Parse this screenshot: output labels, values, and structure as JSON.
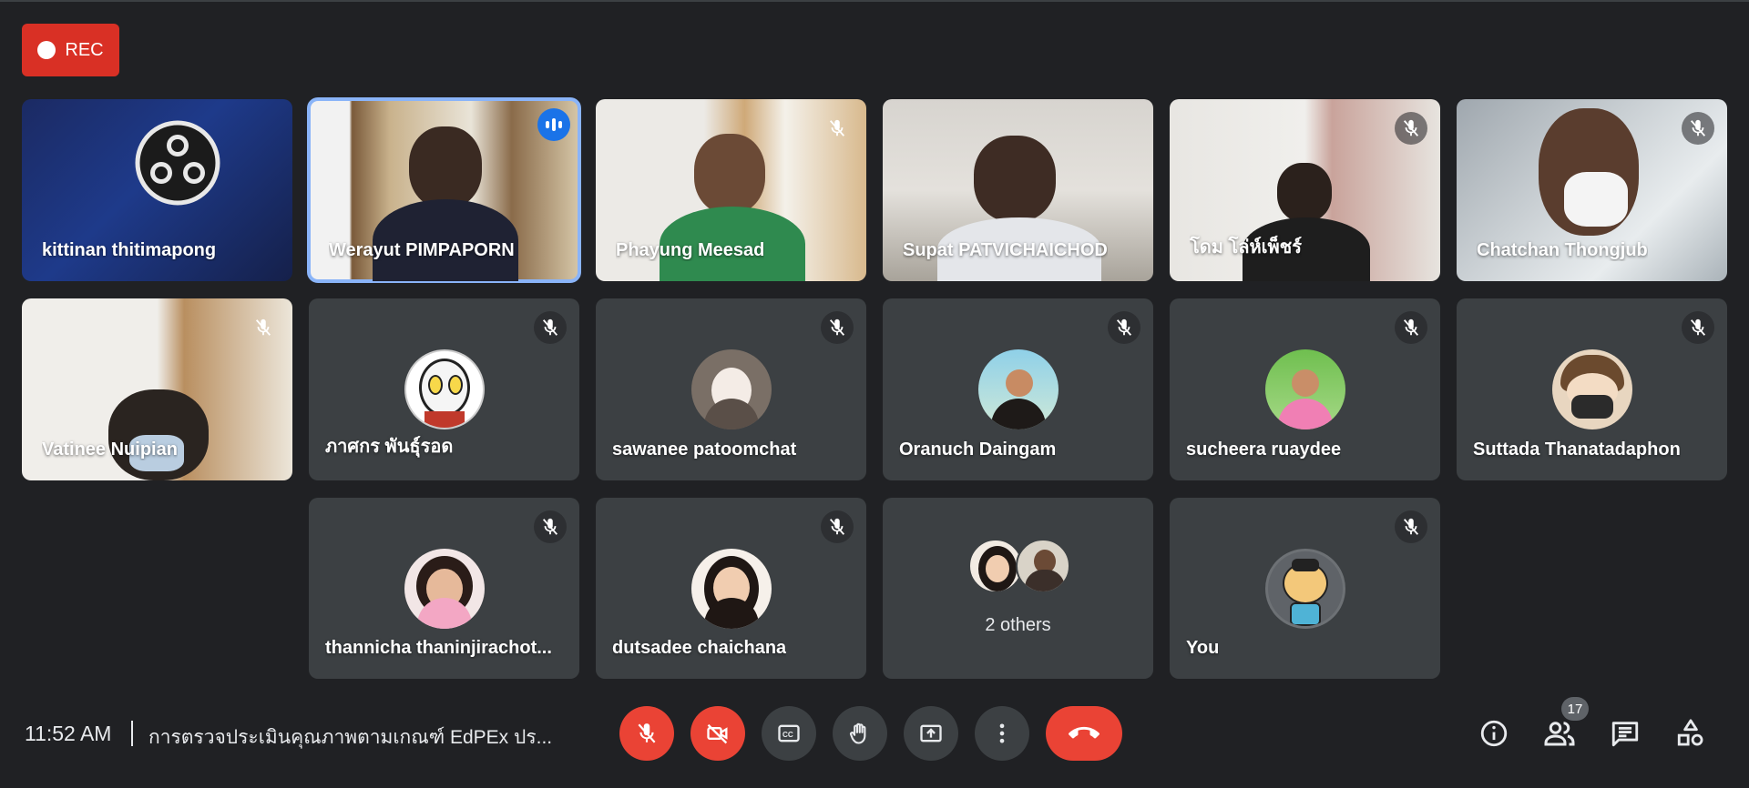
{
  "recording": {
    "label": "REC"
  },
  "participants": [
    {
      "name": "kittinan thitimapong"
    },
    {
      "name": "Werayut PIMPAPORN"
    },
    {
      "name": "Phayung Meesad"
    },
    {
      "name": "Supat PATVICHAICHOD"
    },
    {
      "name": "โดม โล่ห์เพ็ชร์"
    },
    {
      "name": "Chatchan Thongjub"
    },
    {
      "name": "Vatinee Nuipian"
    },
    {
      "name": "ภาศกร พันธุ์รอด"
    },
    {
      "name": "sawanee patoomchat"
    },
    {
      "name": "Oranuch Daingam"
    },
    {
      "name": "sucheera ruaydee"
    },
    {
      "name": "Suttada Thanatadaphon"
    },
    {
      "name": "thannicha thaninjirachot..."
    },
    {
      "name": "dutsadee chaichana"
    },
    {
      "name": "2 others"
    },
    {
      "name": "You"
    }
  ],
  "bottom_bar": {
    "time": "11:52 AM",
    "meeting_title": "การตรวจประเมินคุณภาพตามเกณฑ์ EdPEx ปร...",
    "people_count": "17"
  },
  "icons": {
    "mic_off": "mic-off-icon",
    "camera_off": "videocam-off-icon",
    "captions": "closed-caption-icon",
    "raise_hand": "hand-icon",
    "present": "present-screen-icon",
    "more": "more-vert-icon",
    "end_call": "call-end-icon",
    "info": "info-icon",
    "people": "people-icon",
    "chat": "chat-icon",
    "activities": "activities-icon"
  },
  "colors": {
    "background": "#202124",
    "tile": "#3c4043",
    "accent": "#8ab4f8",
    "danger": "#ea4335",
    "rec": "#d93025"
  }
}
